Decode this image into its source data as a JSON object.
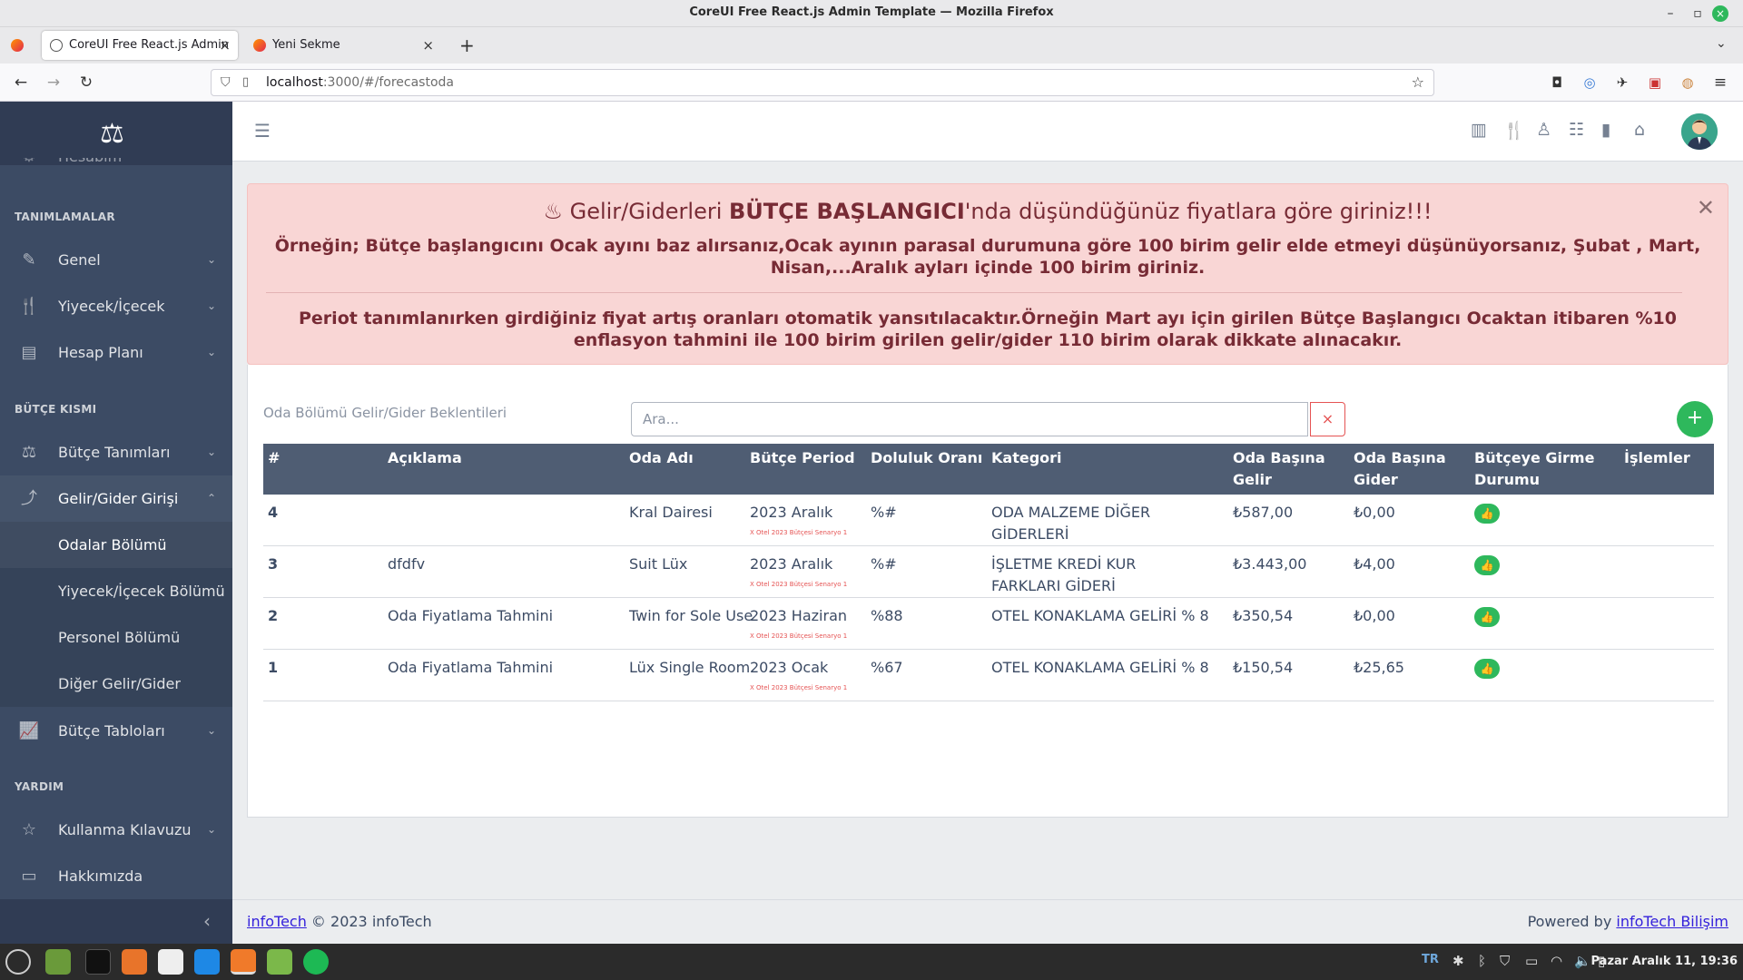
{
  "window": {
    "title": "CoreUI Free React.js Admin Template — Mozilla Firefox"
  },
  "tabs": [
    {
      "label": "CoreUI Free React.js Admin"
    },
    {
      "label": "Yeni Sekme"
    }
  ],
  "url": {
    "host": "localhost",
    "path": ":3000/#/forecastoda"
  },
  "sidebar": {
    "partial_item": "Hesabım",
    "sections": {
      "tanimlamalar": "TANIMLAMALAR",
      "butce": "BÜTÇE KISMI",
      "yardim": "YARDIM"
    },
    "items": {
      "genel": "Genel",
      "yiyecek": "Yiyecek/İçecek",
      "hesap_plani": "Hesap Planı",
      "butce_tanimlari": "Bütçe Tanımları",
      "gelir_gider": "Gelir/Gider Girişi",
      "odalar": "Odalar Bölümü",
      "yiyecek_bolumu": "Yiyecek/İçecek Bölümü",
      "personel": "Personel Bölümü",
      "diger": "Diğer Gelir/Gider",
      "butce_tablolari": "Bütçe Tabloları",
      "kilavuz": "Kullanma Kılavuzu",
      "hakkimizda": "Hakkımızda"
    }
  },
  "alert": {
    "heading_pre": "Gelir/Giderleri ",
    "heading_bold": "BÜTÇE BAŞLANGICI",
    "heading_post": "'nda düşündüğünüz fiyatlara göre giriniz!!!",
    "p1": "Örneğin; Bütçe başlangıcını Ocak ayını baz alırsanız,Ocak ayının parasal durumuna göre 100 birim gelir elde etmeyi düşünüyorsanız, Şubat , Mart, Nisan,...Aralık ayları içinde 100 birim giriniz.",
    "p2": "Periot tanımlanırken girdiğiniz fiyat artış oranları otomatik yansıtılacaktır.Örneğin Mart ayı için girilen Bütçe Başlangıcı Ocaktan itibaren %10 enflasyon tahmini ile 100 birim girilen gelir/gider 110 birim olarak dikkate alınacakır."
  },
  "card": {
    "title": "Oda Bölümü Gelir/Gider Beklentileri",
    "search_placeholder": "Ara...",
    "clear": "×",
    "add": "+"
  },
  "table": {
    "headers": {
      "no": "#",
      "aciklama": "Açıklama",
      "oda": "Oda Adı",
      "period": "Bütçe Period",
      "doluluk": "Doluluk Oranı",
      "kategori": "Kategori",
      "gelir1": "Oda Başına",
      "gelir2": "Gelir",
      "gider1": "Oda Başına",
      "gider2": "Gider",
      "durum1": "Bütçeye Girme",
      "durum2": "Durumu",
      "islemler": "İşlemler"
    },
    "rows": [
      {
        "no": "4",
        "aciklama": "",
        "oda": "Kral Dairesi",
        "period": "2023 Aralık",
        "sub": "X Otel 2023 Bütçesi Senaryo 1",
        "doluluk": "%#",
        "kategori": "ODA MALZEME DİĞER GİDERLERİ",
        "gelir": "₺587,00",
        "gider": "₺0,00"
      },
      {
        "no": "3",
        "aciklama": "dfdfv",
        "oda": "Suit Lüx",
        "period": "2023 Aralık",
        "sub": "X Otel 2023 Bütçesi Senaryo 1",
        "doluluk": "%#",
        "kategori": "İŞLETME KREDİ KUR FARKLARI GİDERİ",
        "gelir": "₺3.443,00",
        "gider": "₺4,00"
      },
      {
        "no": "2",
        "aciklama": "Oda Fiyatlama Tahmini",
        "oda": "Twin for Sole Use",
        "period": "2023 Haziran",
        "sub": "X Otel 2023 Bütçesi Senaryo 1",
        "doluluk": "%88",
        "kategori": "OTEL KONAKLAMA GELİRİ % 8",
        "gelir": "₺350,54",
        "gider": "₺0,00"
      },
      {
        "no": "1",
        "aciklama": "Oda Fiyatlama Tahmini",
        "oda": "Lüx Single Room",
        "period": "2023 Ocak",
        "sub": "X Otel 2023 Bütçesi Senaryo 1",
        "doluluk": "%67",
        "kategori": "OTEL KONAKLAMA GELİRİ % 8",
        "gelir": "₺150,54",
        "gider": "₺25,65"
      }
    ]
  },
  "footer": {
    "left_link": "infoTech",
    "left_text": " © 2023 infoTech",
    "right_text": "Powered by ",
    "right_link": "infoTech Bilişim"
  },
  "taskbar": {
    "lang": "TR",
    "clock": "Pazar Aralık 11, 19:36"
  },
  "colors": {
    "sidebar": "#3c4b64",
    "table_header": "#4f5d73",
    "success": "#2eb85c",
    "danger": "#e55353",
    "alert_bg": "#f9d6d5",
    "alert_text": "#772b35"
  }
}
